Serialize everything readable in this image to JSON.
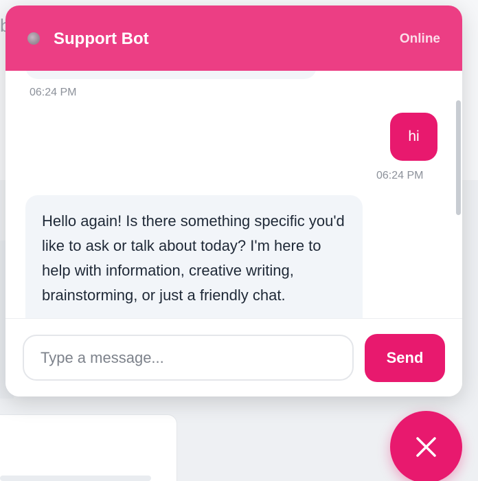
{
  "header": {
    "title": "Support Bot",
    "status": "Online"
  },
  "messages": [
    {
      "sender": "bot",
      "text": "",
      "time": "06:24 PM"
    },
    {
      "sender": "user",
      "text": "hi",
      "time": "06:24 PM"
    },
    {
      "sender": "bot",
      "text": "Hello again! Is there something specific you'd like to ask or talk about today? I'm here to help with information, creative writing, brainstorming, or just a friendly chat."
    }
  ],
  "input": {
    "placeholder": "Type a message...",
    "value": ""
  },
  "send_button": {
    "label": "Send"
  },
  "background": {
    "letter": "b"
  },
  "icons": {
    "status": "status-dot-icon",
    "close": "close-icon"
  },
  "colors": {
    "header": "#ec3e84",
    "accent": "#e8196e",
    "bot_bubble": "#f2f5f9"
  }
}
